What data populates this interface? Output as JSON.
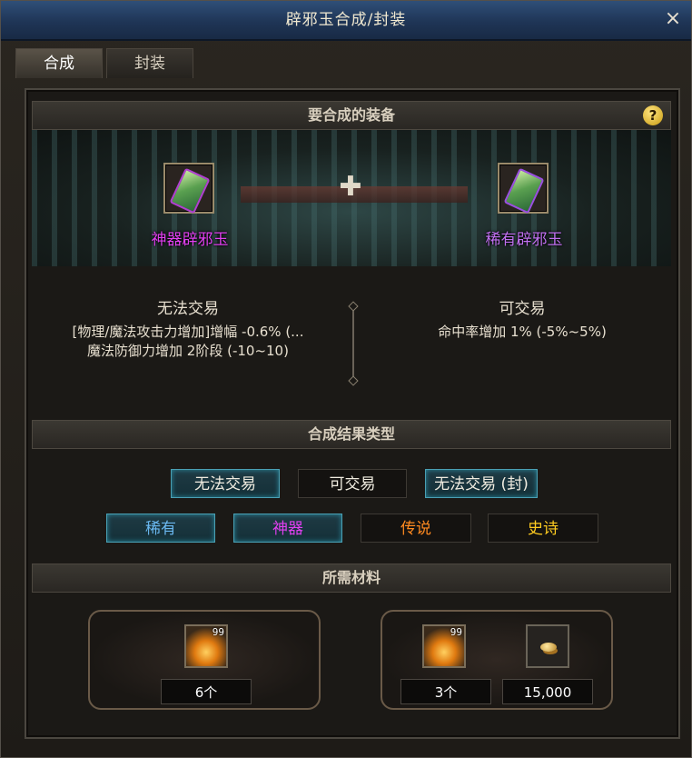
{
  "window": {
    "title": "辟邪玉合成/封装",
    "close_label": "×"
  },
  "tabs": [
    {
      "label": "合成"
    },
    {
      "label": "封装"
    }
  ],
  "equip_section": {
    "header": "要合成的装备",
    "help_label": "?",
    "left_item": {
      "name": "神器辟邪玉",
      "name_color": "#e040f0"
    },
    "right_item": {
      "name": "稀有辟邪玉",
      "name_color": "#c070f0"
    },
    "plus_label": "✚",
    "left_info": {
      "trade": "无法交易",
      "line1": "[物理/魔法攻击力增加]增幅 -0.6% (...",
      "line2": "魔法防御力增加 2阶段 (-10~10)"
    },
    "right_info": {
      "trade": "可交易",
      "line1": "命中率增加 1% (-5%~5%)"
    }
  },
  "result_section": {
    "header": "合成结果类型",
    "trade_options": [
      {
        "label": "无法交易",
        "selected": true
      },
      {
        "label": "可交易",
        "selected": false
      },
      {
        "label": "无法交易 (封)",
        "selected": true
      }
    ],
    "grade_options": [
      {
        "label": "稀有",
        "color": "#6ab8f0",
        "selected": true
      },
      {
        "label": "神器",
        "color": "#e040f0",
        "selected": true
      },
      {
        "label": "传说",
        "color": "#ff8a20",
        "selected": false
      },
      {
        "label": "史诗",
        "color": "#ffcc20",
        "selected": false
      }
    ]
  },
  "materials_section": {
    "header": "所需材料",
    "left": {
      "stack": "99",
      "qty": "6个"
    },
    "right": {
      "stack": "99",
      "qty": "3个",
      "gold": "15,000"
    }
  }
}
